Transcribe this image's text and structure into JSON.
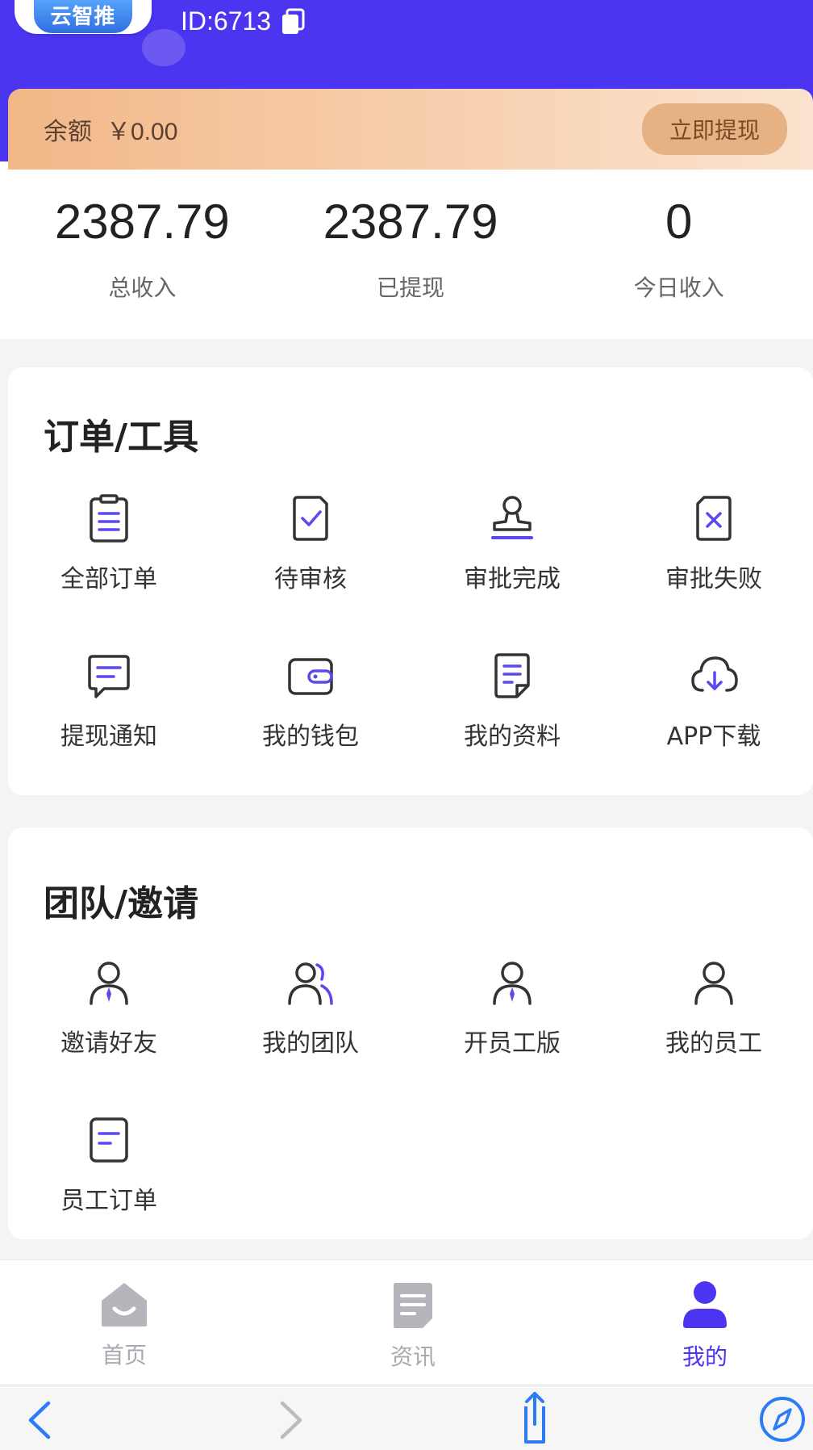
{
  "header": {
    "logo_text": "云智推",
    "user_id": "ID:6713"
  },
  "balance": {
    "label": "余额",
    "amount": "￥0.00",
    "withdraw_button": "立即提现"
  },
  "stats": [
    {
      "value": "2387.79",
      "label": "总收入"
    },
    {
      "value": "2387.79",
      "label": "已提现"
    },
    {
      "value": "0",
      "label": "今日收入"
    }
  ],
  "orders_tools": {
    "title": "订单/工具",
    "items": [
      {
        "label": "全部订单",
        "icon": "clipboard-list-icon"
      },
      {
        "label": "待审核",
        "icon": "document-check-icon"
      },
      {
        "label": "审批完成",
        "icon": "stamp-icon"
      },
      {
        "label": "审批失败",
        "icon": "document-x-icon"
      },
      {
        "label": "提现通知",
        "icon": "message-icon"
      },
      {
        "label": "我的钱包",
        "icon": "wallet-icon"
      },
      {
        "label": "我的资料",
        "icon": "profile-doc-icon"
      },
      {
        "label": "APP下载",
        "icon": "cloud-download-icon"
      }
    ]
  },
  "team_invite": {
    "title": "团队/邀请",
    "items": [
      {
        "label": "邀请好友",
        "icon": "user-tie-icon"
      },
      {
        "label": "我的团队",
        "icon": "users-icon"
      },
      {
        "label": "开员工版",
        "icon": "user-tie-icon"
      },
      {
        "label": "我的员工",
        "icon": "user-icon"
      },
      {
        "label": "员工订单",
        "icon": "document-lines-icon"
      }
    ]
  },
  "tabbar": {
    "tabs": [
      {
        "label": "首页",
        "icon": "home-icon",
        "active": false
      },
      {
        "label": "资讯",
        "icon": "news-icon",
        "active": false
      },
      {
        "label": "我的",
        "icon": "person-icon",
        "active": true
      }
    ]
  },
  "colors": {
    "primary": "#4c35f0",
    "icon_stroke": "#333333",
    "accent": "#5a48f0",
    "inactive_tab": "#a9a9b0"
  }
}
